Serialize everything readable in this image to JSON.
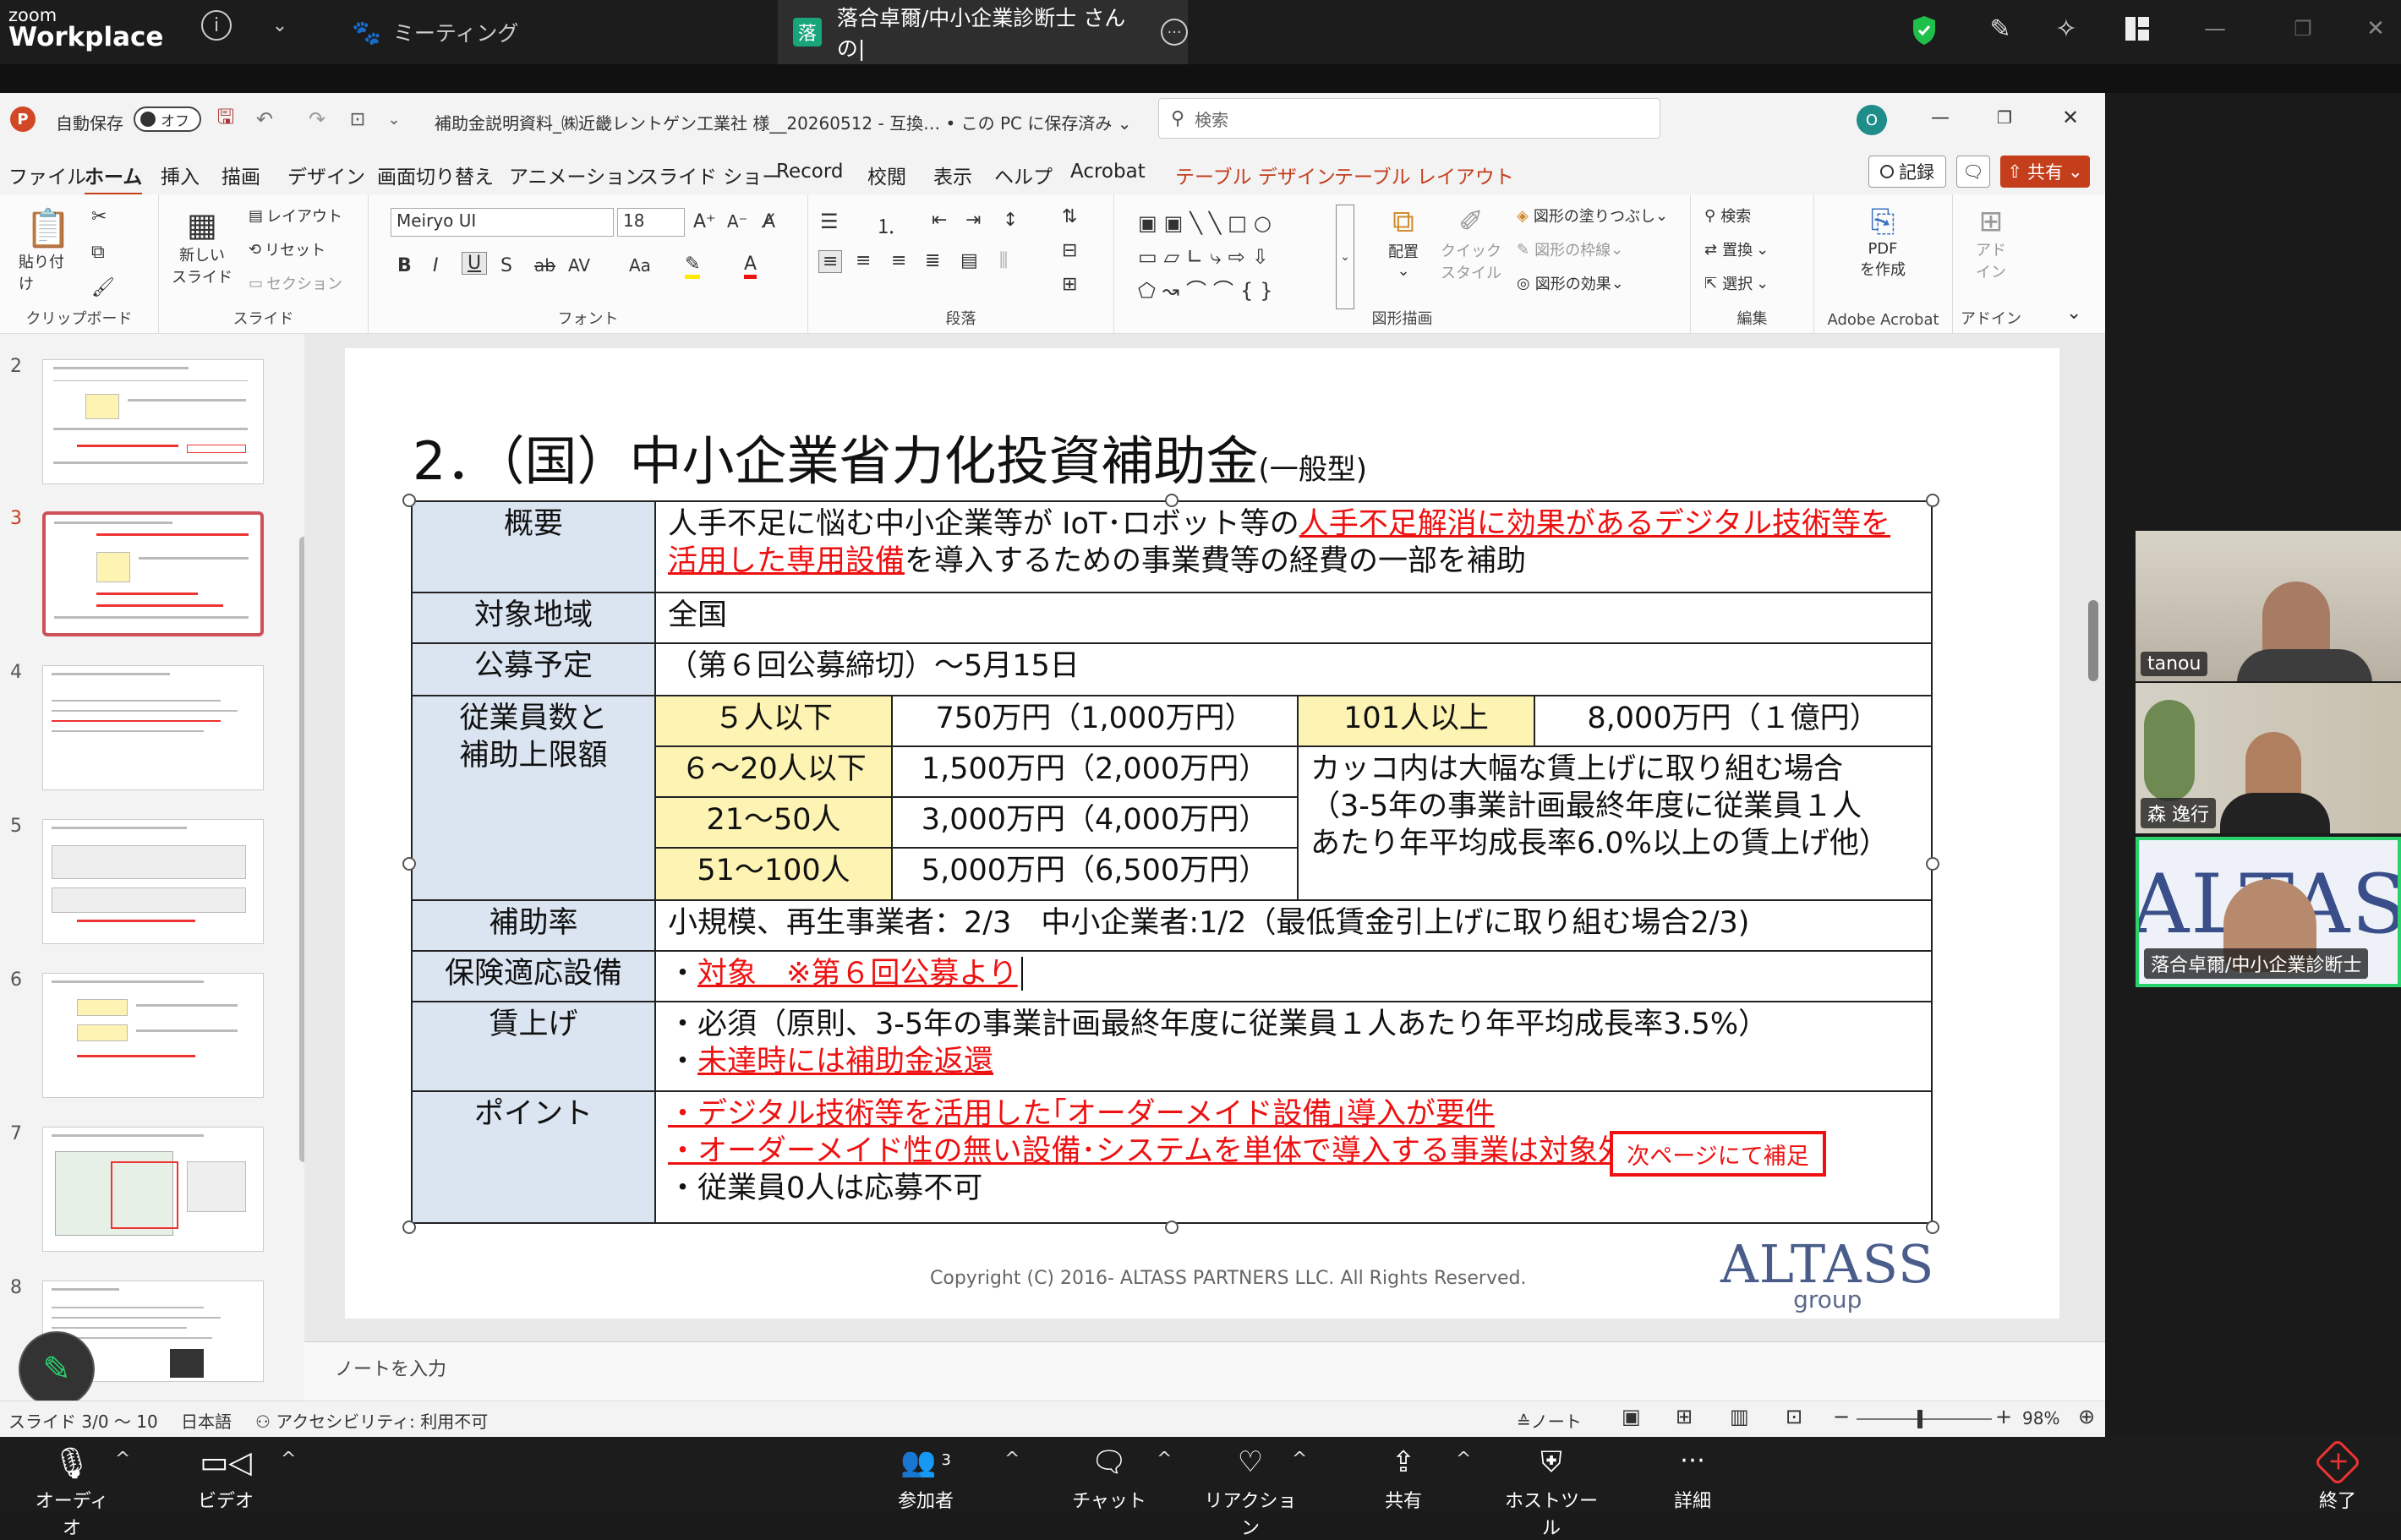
{
  "zoom": {
    "logo_top": "zoom",
    "logo_bottom": "Workplace",
    "meeting_tab": "ミーティング",
    "share_tab_avatar": "落",
    "share_tab_label": "落合卓爾/中小企業診断士 さんの|",
    "bottom": {
      "audio": "オーディオ",
      "video": "ビデオ",
      "participants": "参加者",
      "participants_count": "3",
      "chat": "チャット",
      "reactions": "リアクション",
      "share": "共有",
      "host_tools": "ホストツール",
      "more": "詳細",
      "end": "終了"
    },
    "participants_list": [
      {
        "name": "tanou"
      },
      {
        "name": "森 逸行"
      },
      {
        "name": "落合卓爾/中小企業診断士"
      }
    ]
  },
  "ppt": {
    "autosave": "自動保存",
    "autosave_state": "オフ",
    "file_title": "補助金説明資料_㈱近畿レントゲン工業社 様__20260512 - 互換… • この PC に保存済み ⌄",
    "search_placeholder": "検索",
    "user_initial": "O",
    "menu": [
      "ファイル",
      "ホーム",
      "挿入",
      "描画",
      "デザイン",
      "画面切り替え",
      "アニメーション",
      "スライド ショー",
      "Record",
      "校閲",
      "表示",
      "ヘルプ",
      "Acrobat",
      "テーブル デザイン",
      "テーブル レイアウト"
    ],
    "record_button": "記録",
    "share_button": "共有",
    "ribbon": {
      "paste": "貼り付け",
      "clipboard": "クリップボード",
      "new_slide": "新しい",
      "new_slide2": "スライド",
      "layout": "レイアウト",
      "reset": "リセット",
      "section": "セクション",
      "slides": "スライド",
      "font_name": "Meiryo UI",
      "font_size": "18",
      "font": "フォント",
      "paragraph": "段落",
      "arrange": "配置",
      "quick_style": "クイック",
      "quick_style2": "スタイル",
      "shape_fill": "図形の塗りつぶし",
      "shape_outline": "図形の枠線",
      "shape_effect": "図形の効果",
      "drawing": "図形描画",
      "find": "検索",
      "replace": "置換",
      "select": "選択",
      "editing": "編集",
      "pdf": "PDF",
      "pdf2": "を作成",
      "acrobat": "Adobe Acrobat",
      "addin": "アド",
      "addin2": "イン",
      "addin_group": "アドイン"
    },
    "thumb_numbers": [
      "2",
      "3",
      "4",
      "5",
      "6",
      "7",
      "8"
    ],
    "notes_placeholder": "ノートを入力",
    "status": {
      "slide": "スライド 3/0 ～ 10",
      "lang": "日本語",
      "accessibility": "アクセシビリティ: 利用不可",
      "notes": "ノート",
      "zoom": "98%"
    }
  },
  "slide": {
    "title": "2．（国）中小企業省力化投資補助金",
    "title_sub": "(一般型)",
    "rows": {
      "overview_h": "概要",
      "overview_a": "人手不足に悩む中小企業等が IoT･ロボット等の",
      "overview_red": "人手不足解消に効果があるデジタル技術等を活用した専用設備",
      "overview_b": "を導入するための事業費等の経費の一部を補助",
      "region_h": "対象地域",
      "region": "全国",
      "schedule_h": "公募予定",
      "schedule": "（第６回公募締切）～5月15日",
      "emp_h1": "従業員数と",
      "emp_h2": "補助上限額",
      "emp": [
        {
          "label": "５人以下",
          "amount": "750万円（1,000万円）"
        },
        {
          "label": "６～20人以下",
          "amount": "1,500万円（2,000万円）"
        },
        {
          "label": "21～50人",
          "amount": "3,000万円（4,000万円）"
        },
        {
          "label": "51～100人",
          "amount": "5,000万円（6,500万円）"
        }
      ],
      "emp_big_label": "101人以上",
      "emp_big_amount": "8,000万円（１億円）",
      "emp_note1": "カッコ内は大幅な賃上げに取り組む場合",
      "emp_note2": "（3-5年の事業計画最終年度に従業員１人",
      "emp_note3": "あたり年平均成長率6.0%以上の賃上げ他）",
      "rate_h": "補助率",
      "rate": "小規模、再生事業者：2/3　中小企業者:1/2（最低賃金引上げに取り組む場合2/3)",
      "insurance_h": "保険適応設備",
      "insurance_dot": "・",
      "insurance": "対象　※第６回公募より",
      "wage_h": "賃上げ",
      "wage1": "・必須（原則、3-5年の事業計画最終年度に従業員１人あたり年平均成長率3.5%）",
      "wage2_dot": "・",
      "wage2": "未達時には補助金返還",
      "point_h": "ポイント",
      "point1": "・デジタル技術等を活用した｢オーダーメイド設備｣導入が要件",
      "point2": "・オーダーメイド性の無い設備･システムを単体で導入する事業は対象外",
      "point3": "・従業員0人は応募不可"
    },
    "next_page": "次ページにて補足",
    "copyright": "Copyright (C) 2016- ALTASS PARTNERS LLC. All Rights Reserved.",
    "logo_big": "ALTASS",
    "logo_small": "group"
  },
  "colors": {
    "accent_red": "#e11111",
    "header_blue": "#dbe5f1",
    "cell_yellow": "#fdf3b2",
    "ppt_red": "#c43e1c"
  }
}
